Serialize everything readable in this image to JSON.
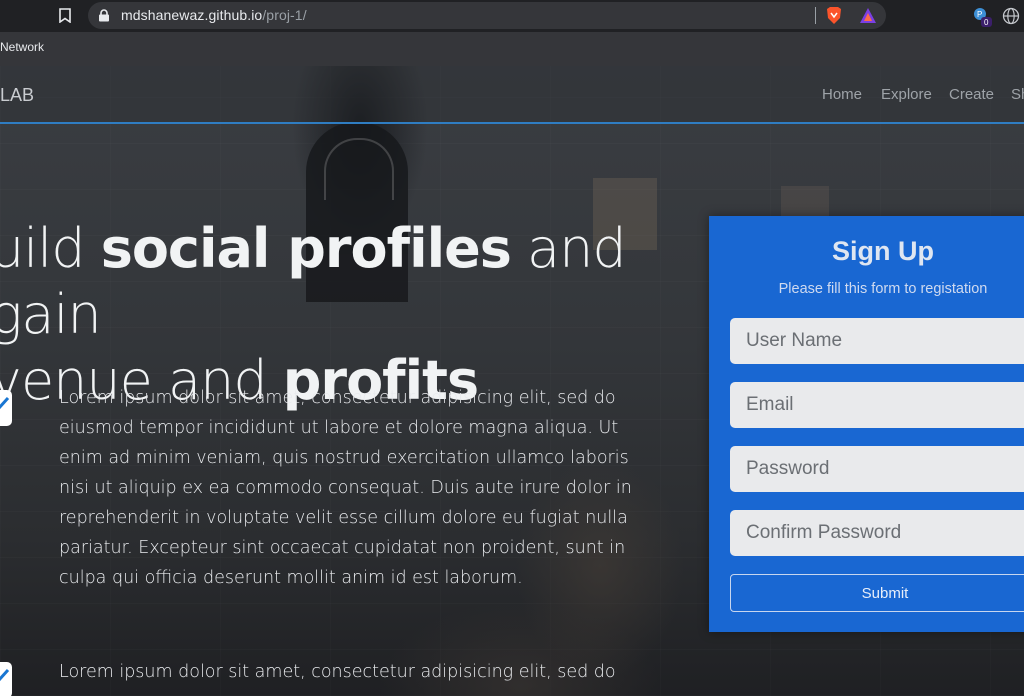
{
  "browser": {
    "url_host": "mdshanewaz.github.io",
    "url_path": "/proj-1/",
    "bookmark_label": "Network",
    "extension_badge": "0"
  },
  "nav": {
    "brand": "LAB",
    "links": [
      "Home",
      "Explore",
      "Create",
      "Sh"
    ]
  },
  "hero": {
    "headline_line1_pre": "uild ",
    "headline_line1_bold": "social profiles",
    "headline_line1_post": " and gain",
    "headline_line2_pre": "venue and ",
    "headline_line2_bold": "profits",
    "paragraph1": "Lorem ipsum dolor sit amet, consectetur adipisicing elit, sed do eiusmod tempor incididunt ut labore et dolore magna aliqua. Ut enim ad minim veniam, quis nostrud exercitation ullamco laboris nisi ut aliquip ex ea commodo consequat. Duis aute irure dolor in reprehenderit in voluptate velit esse cillum dolore eu fugiat nulla pariatur. Excepteur sint occaecat cupidatat non proident, sunt in culpa qui officia deserunt mollit anim id est laborum.",
    "paragraph2": "Lorem ipsum dolor sit amet, consectetur adipisicing elit, sed do"
  },
  "signup": {
    "title": "Sign Up",
    "subtitle": "Please fill this form to registation",
    "username_placeholder": "User Name",
    "email_placeholder": "Email",
    "password_placeholder": "Password",
    "confirm_placeholder": "Confirm Password",
    "submit_label": "Submit"
  },
  "colors": {
    "card": "#1967d2",
    "nav_border": "#2f7dc2"
  }
}
